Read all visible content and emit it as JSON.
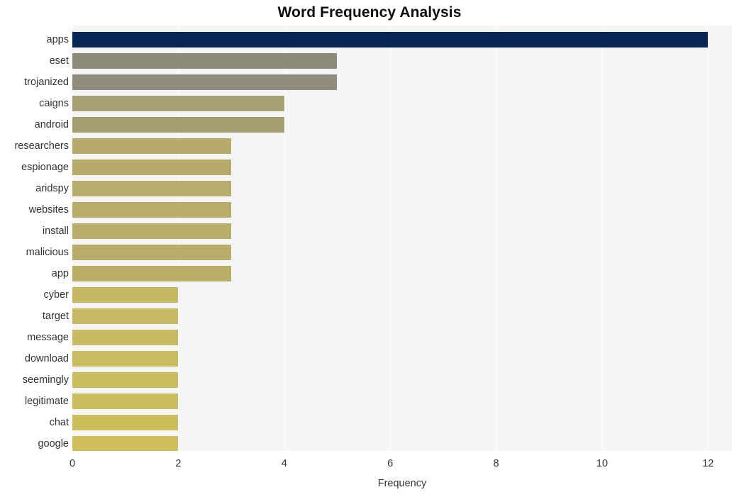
{
  "chart_data": {
    "type": "bar",
    "orientation": "horizontal",
    "title": "Word Frequency Analysis",
    "xlabel": "Frequency",
    "ylabel": "",
    "xlim": [
      0,
      12.45
    ],
    "xticks": [
      0,
      2,
      4,
      6,
      8,
      10,
      12
    ],
    "xtick_labels": [
      "0",
      "2",
      "4",
      "6",
      "8",
      "10",
      "12"
    ],
    "grid": true,
    "grid_axis": "x",
    "legend": false,
    "categories": [
      "apps",
      "eset",
      "trojanized",
      "caigns",
      "android",
      "researchers",
      "espionage",
      "aridspy",
      "websites",
      "install",
      "malicious",
      "app",
      "cyber",
      "target",
      "message",
      "download",
      "seemingly",
      "legitimate",
      "chat",
      "google"
    ],
    "values": [
      12,
      5,
      5,
      4,
      4,
      3,
      3,
      3,
      3,
      3,
      3,
      3,
      2,
      2,
      2,
      2,
      2,
      2,
      2,
      2
    ],
    "bar_colors": [
      "#062753",
      "#8f8b7a",
      "#918c7b",
      "#a8a075",
      "#a39e72",
      "#b6ab6b",
      "#b6ab6b",
      "#b6ac6b",
      "#b7ac6a",
      "#b8ad69",
      "#b8ad69",
      "#b9ae68",
      "#c6b862",
      "#c7b961",
      "#c8ba60",
      "#c9bb5f",
      "#cabc5e",
      "#cbbd5e",
      "#ccbd5d",
      "#cfbf5c"
    ],
    "plot_background": "#f5f5f5",
    "gridline_color": "#ffffff",
    "figure_background": "#ffffff"
  }
}
